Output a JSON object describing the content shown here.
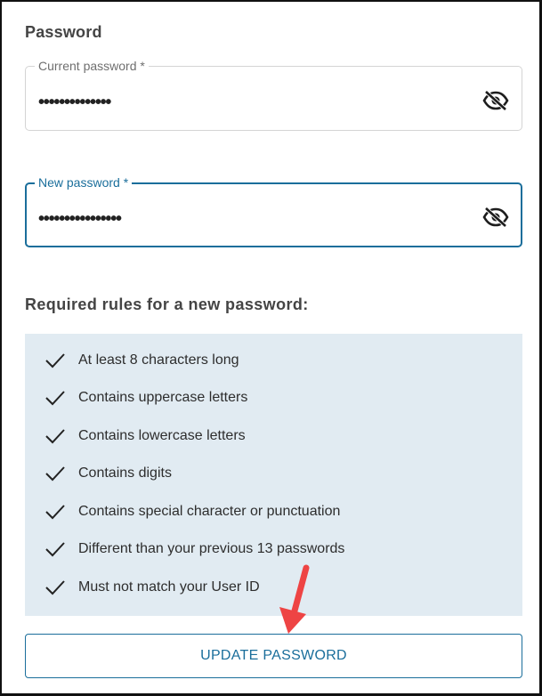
{
  "section_title": "Password",
  "current_password": {
    "label": "Current password *",
    "value": "••••••••••••••"
  },
  "new_password": {
    "label": "New password *",
    "value": "••••••••••••••••"
  },
  "rules_title": "Required rules for a new password:",
  "rules": [
    "At least 8 characters long",
    "Contains uppercase letters",
    "Contains lowercase letters",
    "Contains digits",
    "Contains special character or punctuation",
    "Different than your previous 13 passwords",
    "Must not match your User ID"
  ],
  "update_button_label": "UPDATE PASSWORD",
  "colors": {
    "accent": "#1a6e9b",
    "rules_background": "#e1ebf2",
    "annotation_arrow": "#ee4444"
  },
  "icons": {
    "visibility_toggle": "eye-off-icon",
    "rule_status": "checkmark-icon"
  }
}
